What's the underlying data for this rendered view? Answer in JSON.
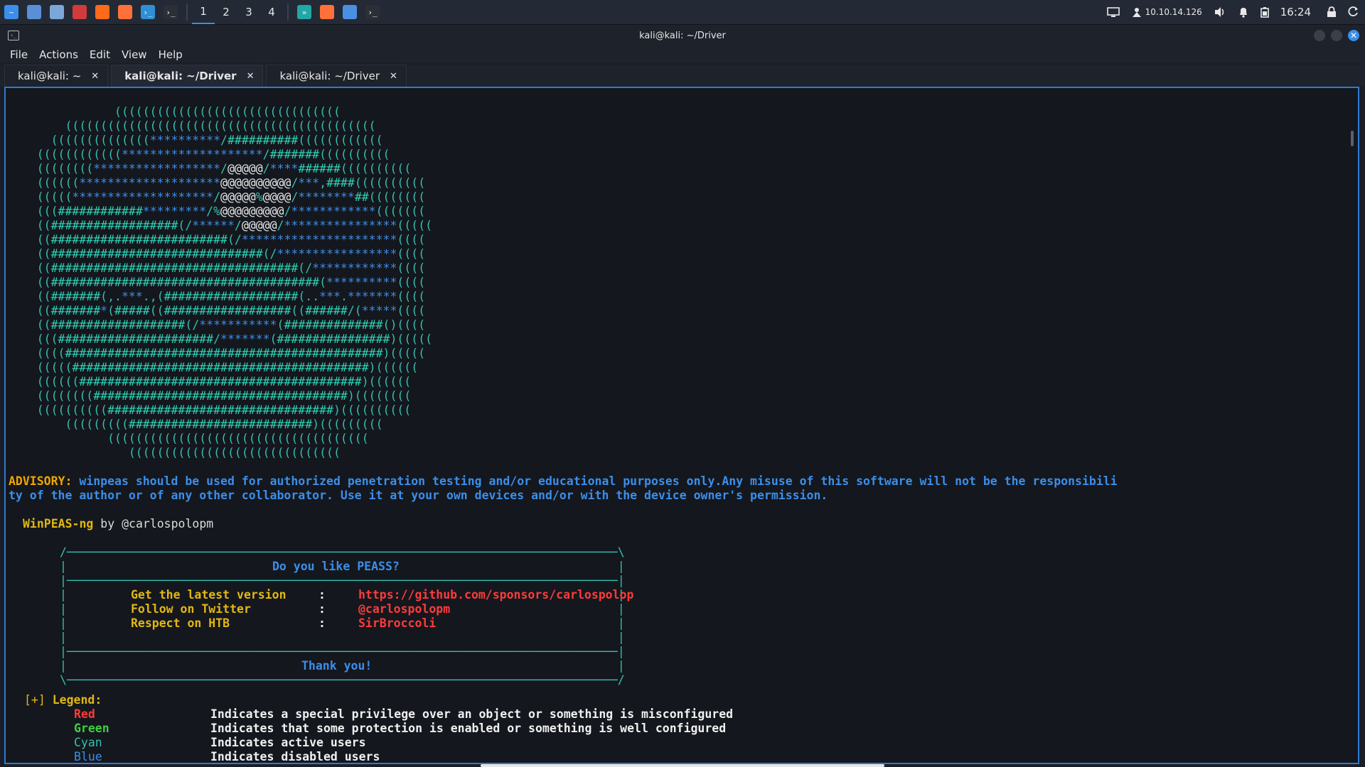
{
  "panel": {
    "apps": [
      {
        "name": "kali-menu-icon",
        "color": "#3b8eea",
        "glyph": "~"
      },
      {
        "name": "desktop-icon",
        "color": "#5a8fd6",
        "glyph": ""
      },
      {
        "name": "file-manager-icon",
        "color": "#7aa7d8",
        "glyph": ""
      },
      {
        "name": "text-editor-icon",
        "color": "#d23b3b",
        "glyph": ""
      },
      {
        "name": "burp-icon",
        "color": "#ff6a1a",
        "glyph": ""
      },
      {
        "name": "firefox-icon",
        "color": "#ff7139",
        "glyph": ""
      },
      {
        "name": "vscode-icon",
        "color": "#2f8fd6",
        "glyph": "›_"
      },
      {
        "name": "terminal-icon",
        "color": "#2b2f36",
        "glyph": "›_"
      }
    ],
    "workspaces": [
      "1",
      "2",
      "3",
      "4"
    ],
    "task_icons": [
      {
        "name": "task-vscode-icon",
        "color": "#23a6a6",
        "glyph": "»"
      },
      {
        "name": "task-firefox-icon",
        "color": "#ff7139",
        "glyph": ""
      },
      {
        "name": "task-chromium-icon",
        "color": "#4a90e2",
        "glyph": ""
      },
      {
        "name": "task-terminal-icon",
        "color": "#2b2f36",
        "glyph": "›_"
      }
    ],
    "ip": "10.10.14.126",
    "clock": "16:24"
  },
  "window": {
    "title": "kali@kali: ~/Driver"
  },
  "menu": [
    "File",
    "Actions",
    "Edit",
    "View",
    "Help"
  ],
  "tabs": [
    {
      "label": "kali@kali: ~",
      "active": false
    },
    {
      "label": "kali@kali: ~/Driver",
      "active": true
    },
    {
      "label": "kali@kali: ~/Driver",
      "active": false
    }
  ],
  "terminal": {
    "advisory_label": "ADVISORY:",
    "advisory_line1": "winpeas should be used for authorized penetration testing and/or educational purposes only.Any misuse of this software will not be the responsibili",
    "advisory_line2": "ty of the author or of any other collaborator. Use it at your own devices and/or with the device owner's permission.",
    "brand": "WinPEAS-ng",
    "brand_by": " by @carlospolopm",
    "box": {
      "title": "Do you like PEASS?",
      "rows": [
        {
          "label": "Get the latest version",
          "value": "https://github.com/sponsors/carlospolop"
        },
        {
          "label": "Follow on Twitter",
          "value": "@carlospolopm"
        },
        {
          "label": "Respect on HTB",
          "value": "SirBroccoli"
        }
      ],
      "footer": "Thank you!"
    },
    "legend_prefix": "[+]",
    "legend_title": "Legend:",
    "legend": [
      {
        "color": "Red",
        "desc": "Indicates a special privilege over an object or something is misconfigured"
      },
      {
        "color": "Green",
        "desc": "Indicates that some protection is enabled or something is well configured"
      },
      {
        "color": "Cyan",
        "desc": "Indicates active users"
      },
      {
        "color": "Blue",
        "desc": "Indicates disabled users"
      }
    ],
    "ascii": [
      "               ((((((((((((((((((((((((((((((((",
      "        ((((((((((((((((((((((((((((((((((((((((((((",
      "      ((((((((((((((**********/##########((((((((((((",
      "    ((((((((((((********************/#######((((((((((",
      "    ((((((((******************/@@@@@/****######((((((((((",
      "    ((((((********************@@@@@@@@@@/***,####((((((((((",
      "    (((((********************/@@@@@%@@@@/********##((((((((",
      "    (((############*********/%@@@@@@@@@/************(((((((",
      "    ((##################(/******/@@@@@/****************(((((",
      "    ((#########################(/**********************((((",
      "    ((##############################(/*****************((((",
      "    ((###################################(/************((((",
      "    ((######################################(**********((((",
      "    ((#######(,.***.,(###################(..***.*******((((",
      "    ((#######*(#####((##################((######/(*****((((",
      "    ((###################(/***********(##############()((((",
      "    (((######################/*******(################)(((((",
      "    ((((#############################################)(((((",
      "    (((((##########################################)((((((",
      "    ((((((########################################)((((((",
      "    ((((((((####################################)((((((((",
      "    ((((((((((################################)((((((((((",
      "        (((((((((##########################)(((((((((",
      "              (((((((((((((((((((((((((((((((((((((",
      "                 (((((((((((((((((((((((((((((("
    ]
  }
}
